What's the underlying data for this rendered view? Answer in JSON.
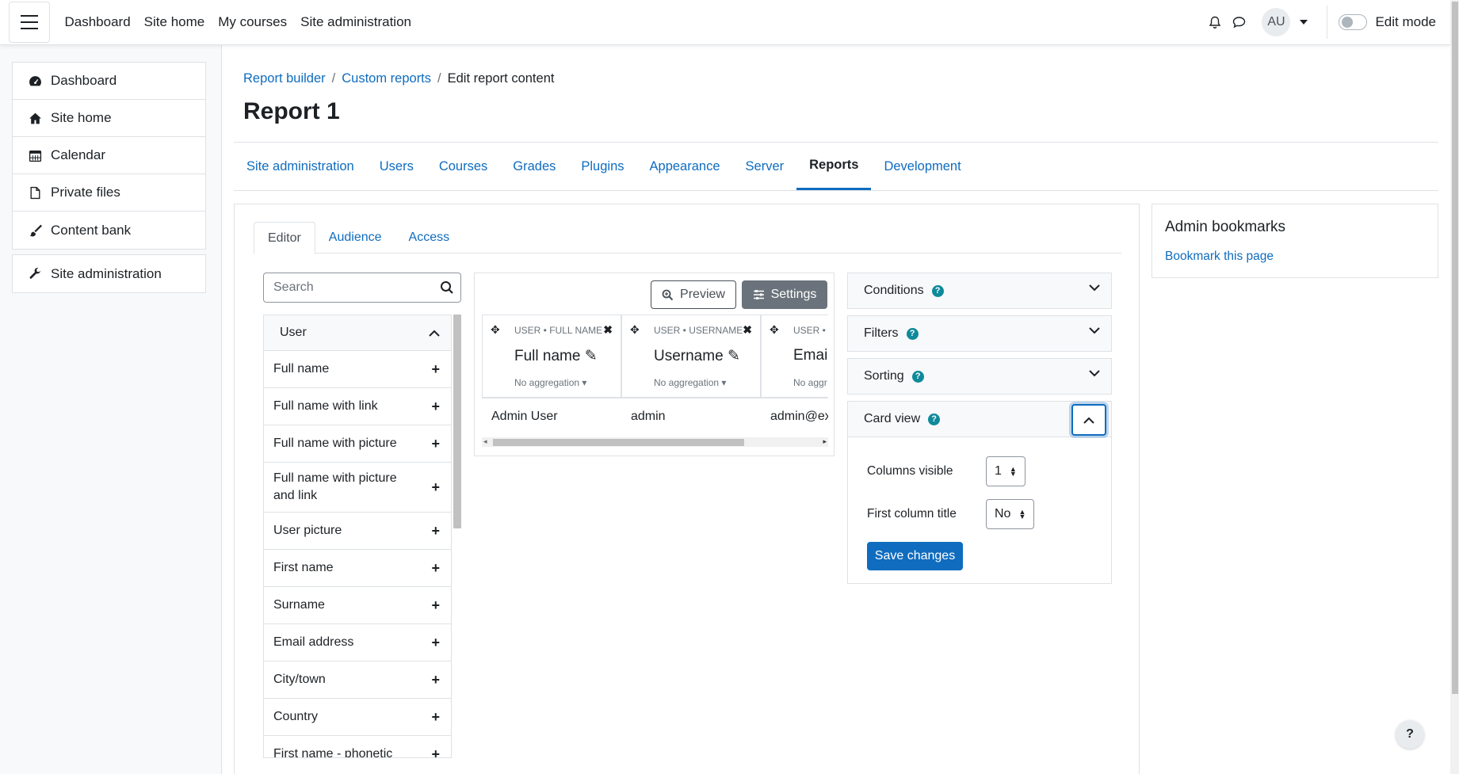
{
  "navbar": {
    "items": [
      "Dashboard",
      "Site home",
      "My courses",
      "Site administration"
    ],
    "avatar_initials": "AU",
    "edit_mode_label": "Edit mode"
  },
  "drawer": {
    "items": [
      "Dashboard",
      "Site home",
      "Calendar",
      "Private files",
      "Content bank"
    ],
    "admin_item": "Site administration"
  },
  "breadcrumb": [
    "Report builder",
    "Custom reports",
    "Edit report content"
  ],
  "page_title": "Report 1",
  "secondary_nav": {
    "tabs": [
      "Site administration",
      "Users",
      "Courses",
      "Grades",
      "Plugins",
      "Appearance",
      "Server",
      "Reports",
      "Development"
    ],
    "active": "Reports"
  },
  "editor_tabs": [
    "Editor",
    "Audience",
    "Access"
  ],
  "search": {
    "placeholder": "Search"
  },
  "sources": {
    "group": "User",
    "items": [
      "Full name",
      "Full name with link",
      "Full name with picture",
      "Full name with picture and link",
      "User picture",
      "First name",
      "Surname",
      "Email address",
      "City/town",
      "Country",
      "First name - phonetic"
    ]
  },
  "report": {
    "preview_label": "Preview",
    "settings_label": "Settings",
    "columns": [
      {
        "kicker": "USER • FULL NAME",
        "title": "Full name",
        "agg": "No aggregation",
        "cell": "Admin User"
      },
      {
        "kicker": "USER • USERNAME",
        "title": "Username",
        "agg": "No aggregation",
        "cell": "admin"
      },
      {
        "kicker": "USER •",
        "title": "Emai",
        "agg": "No aggr",
        "cell": "admin@ex"
      }
    ]
  },
  "accordions": {
    "conditions": "Conditions",
    "filters": "Filters",
    "sorting": "Sorting",
    "card_view": "Card view",
    "columns_visible_label": "Columns visible",
    "columns_visible_value": "1",
    "first_column_title_label": "First column title",
    "first_column_title_value": "No",
    "save_label": "Save changes"
  },
  "bookmarks": {
    "title": "Admin bookmarks",
    "link": "Bookmark this page"
  },
  "help_fab": "?"
}
